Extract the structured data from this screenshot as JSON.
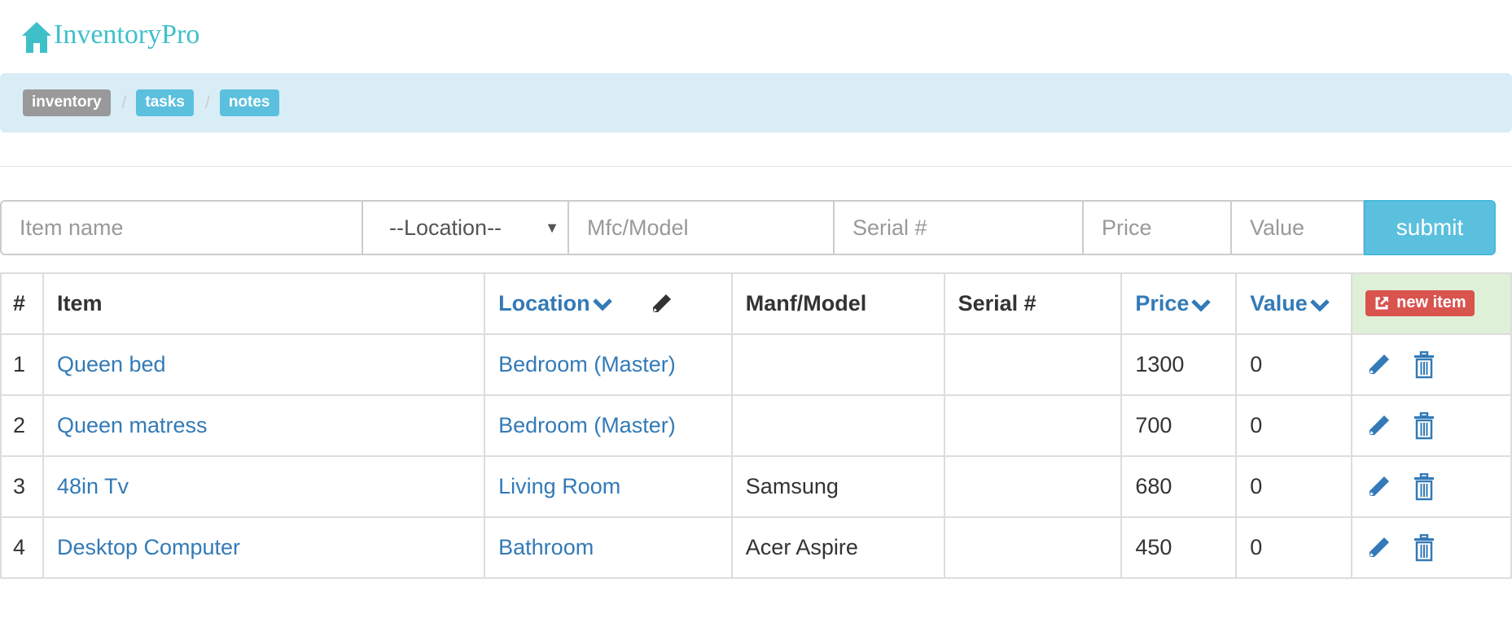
{
  "brand": {
    "name": "InventoryPro"
  },
  "breadcrumbs": [
    {
      "label": "inventory",
      "active": true
    },
    {
      "label": "tasks",
      "active": false
    },
    {
      "label": "notes",
      "active": false
    }
  ],
  "breadcrumb_separator": "/",
  "form": {
    "item_placeholder": "Item name",
    "location_selected": "--Location--",
    "model_placeholder": "Mfc/Model",
    "serial_placeholder": "Serial #",
    "price_placeholder": "Price",
    "value_placeholder": "Value",
    "submit_label": "submit"
  },
  "table": {
    "headers": {
      "index": "#",
      "item": "Item",
      "location": "Location",
      "model": "Manf/Model",
      "serial": "Serial #",
      "price": "Price",
      "value": "Value",
      "new_item": "new item"
    },
    "rows": [
      {
        "index": "1",
        "item": "Queen bed",
        "location": "Bedroom (Master)",
        "model": "",
        "serial": "",
        "price": "1300",
        "value": "0"
      },
      {
        "index": "2",
        "item": "Queen matress",
        "location": "Bedroom (Master)",
        "model": "",
        "serial": "",
        "price": "700",
        "value": "0"
      },
      {
        "index": "3",
        "item": "48in Tv",
        "location": "Living Room",
        "model": "Samsung",
        "serial": "",
        "price": "680",
        "value": "0"
      },
      {
        "index": "4",
        "item": "Desktop Computer",
        "location": "Bathroom",
        "model": "Acer Aspire",
        "serial": "",
        "price": "450",
        "value": "0"
      }
    ]
  },
  "icons": {
    "brand": "home-icon",
    "sort": "chevron-down-icon",
    "edit_column": "pencil-icon",
    "new_item": "external-link-icon",
    "row_edit": "pencil-icon",
    "row_delete": "trash-icon"
  },
  "colors": {
    "brand": "#3fc0c9",
    "link": "#337ab7",
    "info": "#5bc0de",
    "danger": "#d9534f",
    "breadcrumb_bg": "#d9edf7",
    "header_success_bg": "#dff0d8",
    "muted_badge": "#999999"
  }
}
